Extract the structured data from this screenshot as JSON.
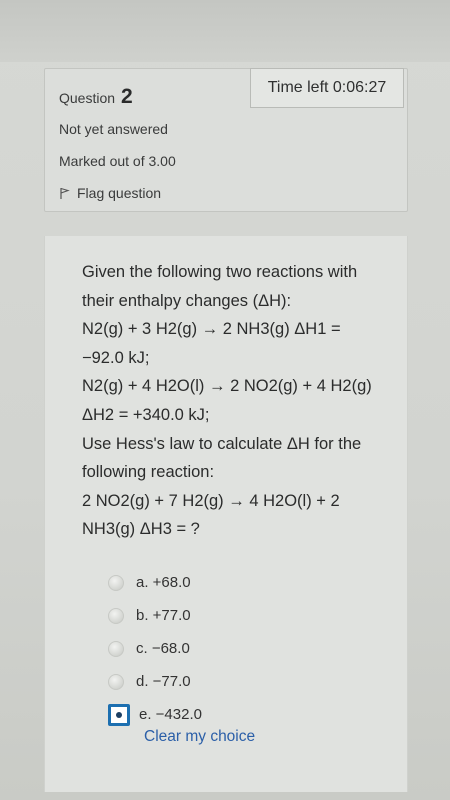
{
  "question": {
    "label": "Question",
    "number": "2",
    "status": "Not yet answered",
    "marks": "Marked out of 3.00",
    "flag_label": "Flag question"
  },
  "timer": {
    "text": "Time left 0:06:27"
  },
  "question_text": {
    "intro": "Given the following two reactions with their enthalpy changes (ΔH):",
    "reaction1": "N2(g) + 3 H2(g) → 2 NH3(g) ΔH1 = −92.0 kJ;",
    "reaction2": "N2(g) + 4 H2O(l) → 2 NO2(g) + 4 H2(g) ΔH2 = +340.0 kJ;",
    "task": "Use Hess's law to calculate ΔH for the following reaction:",
    "target": "2 NO2(g) + 7 H2(g) → 4 H2O(l) + 2 NH3(g) ΔH3 = ?"
  },
  "answers": [
    {
      "label": "a. +68.0",
      "selected": false
    },
    {
      "label": "b. +77.0",
      "selected": false
    },
    {
      "label": "c. −68.0",
      "selected": false
    },
    {
      "label": "d. −77.0",
      "selected": false
    },
    {
      "label": "e. −432.0",
      "selected": true
    }
  ],
  "clear_choice": "Clear my choice",
  "colors": {
    "accent": "#1c6fb0",
    "link": "#2b5fa8"
  }
}
